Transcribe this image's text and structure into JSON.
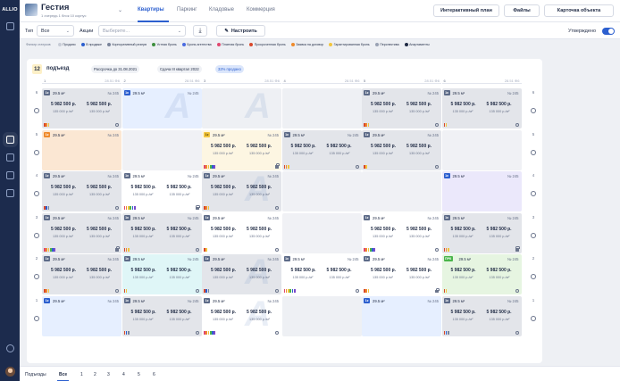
{
  "app": {
    "logo": "ALLIO"
  },
  "project": {
    "title": "Гестия",
    "subtitle": "1 очередь 1 блок 10 корпус"
  },
  "tabs": [
    {
      "label": "Квартиры",
      "active": true
    },
    {
      "label": "Паркинг",
      "active": false
    },
    {
      "label": "Кладовые",
      "active": false
    },
    {
      "label": "Коммерция",
      "active": false
    }
  ],
  "header_buttons": {
    "plan": "Интерактивный план",
    "files": "Файлы",
    "card": "Карточка объекта"
  },
  "filters": {
    "type_label": "Тип",
    "type_value": "Все",
    "promo_label": "Акции",
    "promo_placeholder": "Выберите...",
    "configure": "Настроить",
    "approved": "Утверждено"
  },
  "legend": {
    "title": "Фильтр статусов",
    "items": [
      {
        "label": "Продано",
        "color": "#c8ccd6"
      },
      {
        "label": "В продаже",
        "color": "#2c5fcf"
      },
      {
        "label": "Корпоративный резерв",
        "color": "#7a849a"
      },
      {
        "label": "Устная бронь",
        "color": "#3f8f3f"
      },
      {
        "label": "Бронь агентства",
        "color": "#4a6be0"
      },
      {
        "label": "Платная бронь",
        "color": "#e0486f"
      },
      {
        "label": "Просроченная бронь",
        "color": "#d9482b"
      },
      {
        "label": "Заявка на договор",
        "color": "#ef8a2b"
      },
      {
        "label": "Гарантированная бронь",
        "color": "#f2c53d"
      },
      {
        "label": "Перспектива",
        "color": "#9aa2b4"
      },
      {
        "label": "Апартаменты",
        "color": "#1f2a44"
      }
    ]
  },
  "entrance": {
    "number": "12",
    "title": "подъезд",
    "installment": "Рассрочка до 31.08.2021",
    "delivery": "Сдача III квартал 2022",
    "sold": "32% продано"
  },
  "columns": [
    {
      "n": "1",
      "meta": "28.51 ⊕6"
    },
    {
      "n": "2",
      "meta": "28.51 ⊕6"
    },
    {
      "n": "3",
      "meta": "28.51 ⊕6"
    },
    {
      "n": "4",
      "meta": "28.51 ⊕6"
    },
    {
      "n": "5",
      "meta": "28.51 ⊕6"
    },
    {
      "n": "6",
      "meta": "28.51 ⊕6"
    }
  ],
  "floors": [
    "6",
    "5",
    "4",
    "3",
    "2",
    "1"
  ],
  "apt": {
    "area": "29.5 м²",
    "number": "№ 245",
    "price": "5 982 500 р.",
    "ppm": "135 000 р./м²"
  },
  "cells": [
    {
      "k": "full",
      "bg": "sold",
      "badge": "1к",
      "bc": ""
    },
    {
      "k": "area",
      "bg": "lblue",
      "badge": "1к",
      "bc": "blue",
      "mark": true
    },
    {
      "k": "empty",
      "bg": "ghost",
      "mark": true
    },
    {
      "k": "empty",
      "bg": "ghost"
    },
    {
      "k": "full",
      "bg": "sold",
      "badge": "1к",
      "bc": ""
    },
    {
      "k": "full",
      "bg": "sold",
      "badge": "1к",
      "bc": ""
    },
    {
      "k": "area",
      "bg": "peach",
      "badge": "1к",
      "bc": "orange"
    },
    {
      "k": "empty",
      "bg": "disabled"
    },
    {
      "k": "full",
      "bg": "cream",
      "badge": "1к",
      "bc": "yellow"
    },
    {
      "k": "full",
      "bg": "sold",
      "badge": "1к",
      "bc": ""
    },
    {
      "k": "full",
      "bg": "sold",
      "badge": "1к",
      "bc": ""
    },
    {
      "k": "empty",
      "bg": "disabled"
    },
    {
      "k": "full",
      "bg": "sold",
      "badge": "1к",
      "bc": ""
    },
    {
      "k": "full",
      "bg": "white",
      "badge": "1к",
      "bc": ""
    },
    {
      "k": "full",
      "bg": "sold",
      "badge": "1к",
      "bc": "",
      "mark": true
    },
    {
      "k": "empty",
      "bg": "disabled"
    },
    {
      "k": "empty",
      "bg": "disabled"
    },
    {
      "k": "area",
      "bg": "lav",
      "badge": "1к",
      "bc": "blue"
    },
    {
      "k": "full",
      "bg": "sold",
      "badge": "1к",
      "bc": ""
    },
    {
      "k": "full",
      "bg": "sold",
      "badge": "1к",
      "bc": ""
    },
    {
      "k": "full",
      "bg": "white",
      "badge": "1к",
      "bc": ""
    },
    {
      "k": "empty",
      "bg": "disabled"
    },
    {
      "k": "full",
      "bg": "white",
      "badge": "1к",
      "bc": ""
    },
    {
      "k": "full",
      "bg": "sold",
      "badge": "1к",
      "bc": ""
    },
    {
      "k": "full",
      "bg": "sold",
      "badge": "1к",
      "bc": ""
    },
    {
      "k": "full",
      "bg": "mint",
      "badge": "1к",
      "bc": ""
    },
    {
      "k": "full",
      "bg": "sold",
      "badge": "1к",
      "bc": "",
      "mark": true
    },
    {
      "k": "full",
      "bg": "white",
      "badge": "1к",
      "bc": ""
    },
    {
      "k": "full",
      "bg": "white",
      "badge": "1к",
      "bc": ""
    },
    {
      "k": "full",
      "bg": "gtint",
      "badge": "ПРК",
      "bc": "green"
    },
    {
      "k": "area",
      "bg": "lblue",
      "badge": "1к",
      "bc": "blue"
    },
    {
      "k": "full",
      "bg": "sold",
      "badge": "1к",
      "bc": ""
    },
    {
      "k": "full",
      "bg": "white",
      "badge": "1к",
      "bc": "",
      "mark": true
    },
    {
      "k": "empty",
      "bg": "ghost"
    },
    {
      "k": "area",
      "bg": "lblue",
      "badge": "1к",
      "bc": "blue"
    },
    {
      "k": "full",
      "bg": "sold",
      "badge": "1к",
      "bc": ""
    }
  ],
  "bottom": {
    "label": "Подъезды",
    "items": [
      "Все",
      "1",
      "2",
      "3",
      "4",
      "5",
      "6"
    ]
  }
}
